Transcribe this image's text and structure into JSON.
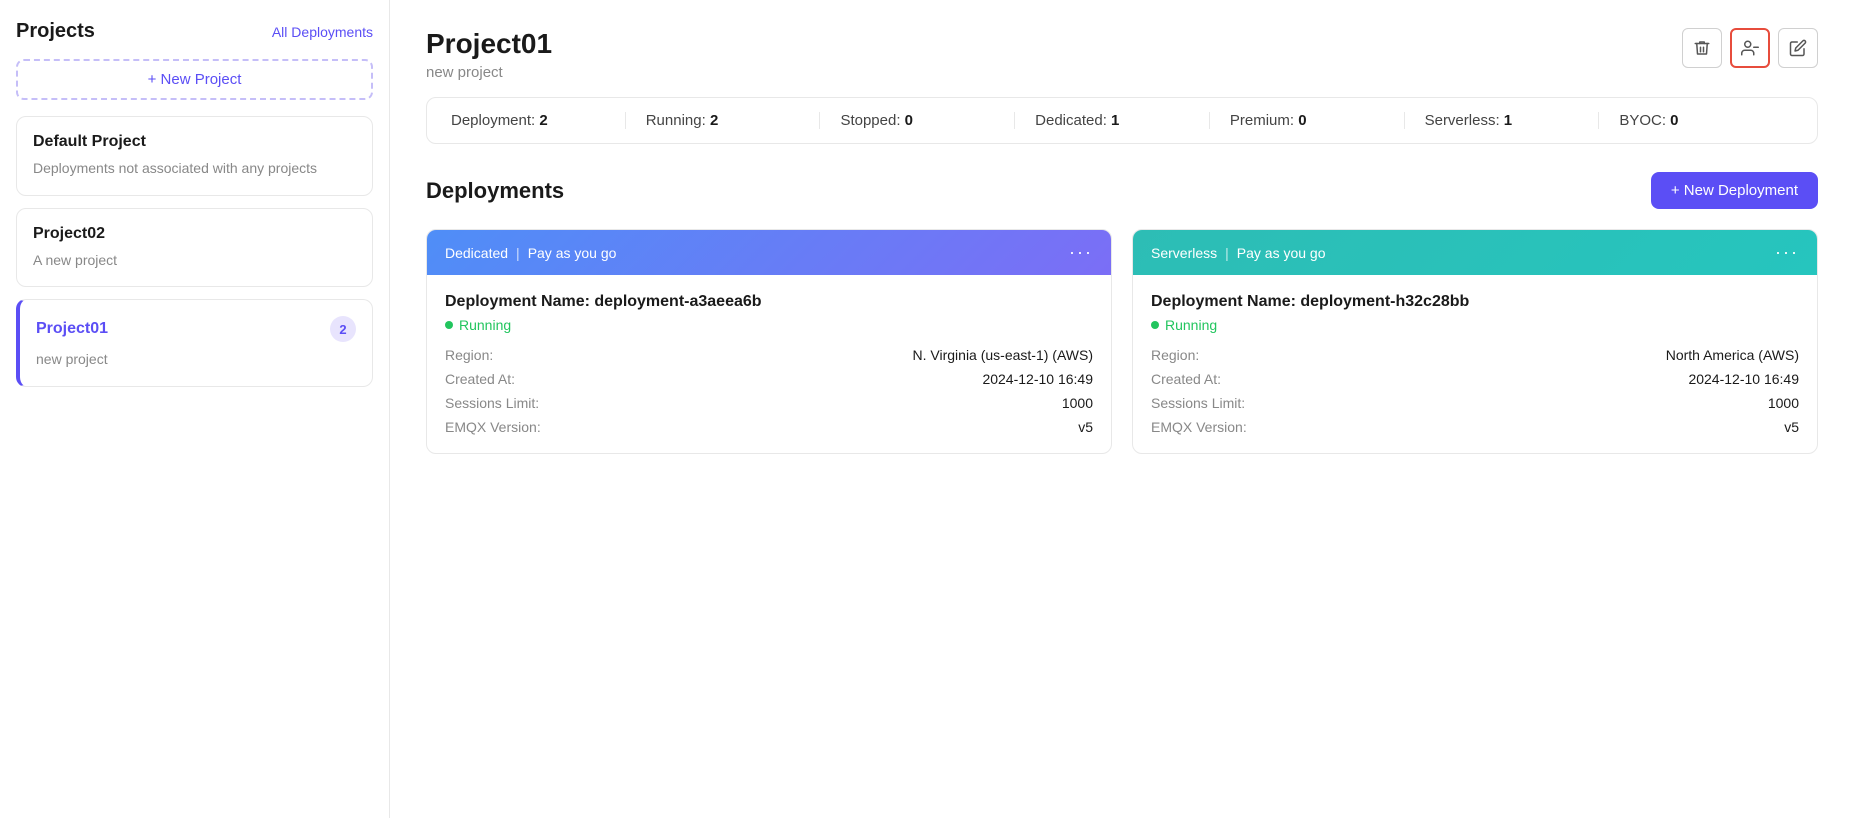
{
  "sidebar": {
    "title": "Projects",
    "all_deployments_label": "All Deployments",
    "new_project_label": "+ New Project",
    "projects": [
      {
        "id": "default",
        "name": "Default Project",
        "description": "Deployments not associated with any projects",
        "active": false,
        "badge": null
      },
      {
        "id": "project02",
        "name": "Project02",
        "description": "A new project",
        "active": false,
        "badge": null
      },
      {
        "id": "project01",
        "name": "Project01",
        "description": "new project",
        "active": true,
        "badge": "2"
      }
    ]
  },
  "main": {
    "project_title": "Project01",
    "project_subtitle": "new project",
    "actions": {
      "delete_label": "🗑",
      "users_label": "👤",
      "edit_label": "✏"
    },
    "stats": [
      {
        "label": "Deployment:",
        "value": "2"
      },
      {
        "label": "Running:",
        "value": "2"
      },
      {
        "label": "Stopped:",
        "value": "0"
      },
      {
        "label": "Dedicated:",
        "value": "1"
      },
      {
        "label": "Premium:",
        "value": "0"
      },
      {
        "label": "Serverless:",
        "value": "1"
      },
      {
        "label": "BYOC:",
        "value": "0"
      }
    ],
    "deployments_section_title": "Deployments",
    "new_deployment_label": "+ New Deployment",
    "deployments": [
      {
        "id": "dep1",
        "type": "Dedicated",
        "plan": "Pay as you go",
        "type_class": "dedicated",
        "name": "Deployment Name: deployment-a3aeea6b",
        "status": "Running",
        "region_label": "Region:",
        "region_value": "N. Virginia (us-east-1) (AWS)",
        "created_label": "Created At:",
        "created_value": "2024-12-10 16:49",
        "sessions_label": "Sessions Limit:",
        "sessions_value": "1000",
        "emqx_label": "EMQX Version:",
        "emqx_value": "v5"
      },
      {
        "id": "dep2",
        "type": "Serverless",
        "plan": "Pay as you go",
        "type_class": "serverless",
        "name": "Deployment Name: deployment-h32c28bb",
        "status": "Running",
        "region_label": "Region:",
        "region_value": "North America (AWS)",
        "created_label": "Created At:",
        "created_value": "2024-12-10 16:49",
        "sessions_label": "Sessions Limit:",
        "sessions_value": "1000",
        "emqx_label": "EMQX Version:",
        "emqx_value": "v5"
      }
    ]
  }
}
